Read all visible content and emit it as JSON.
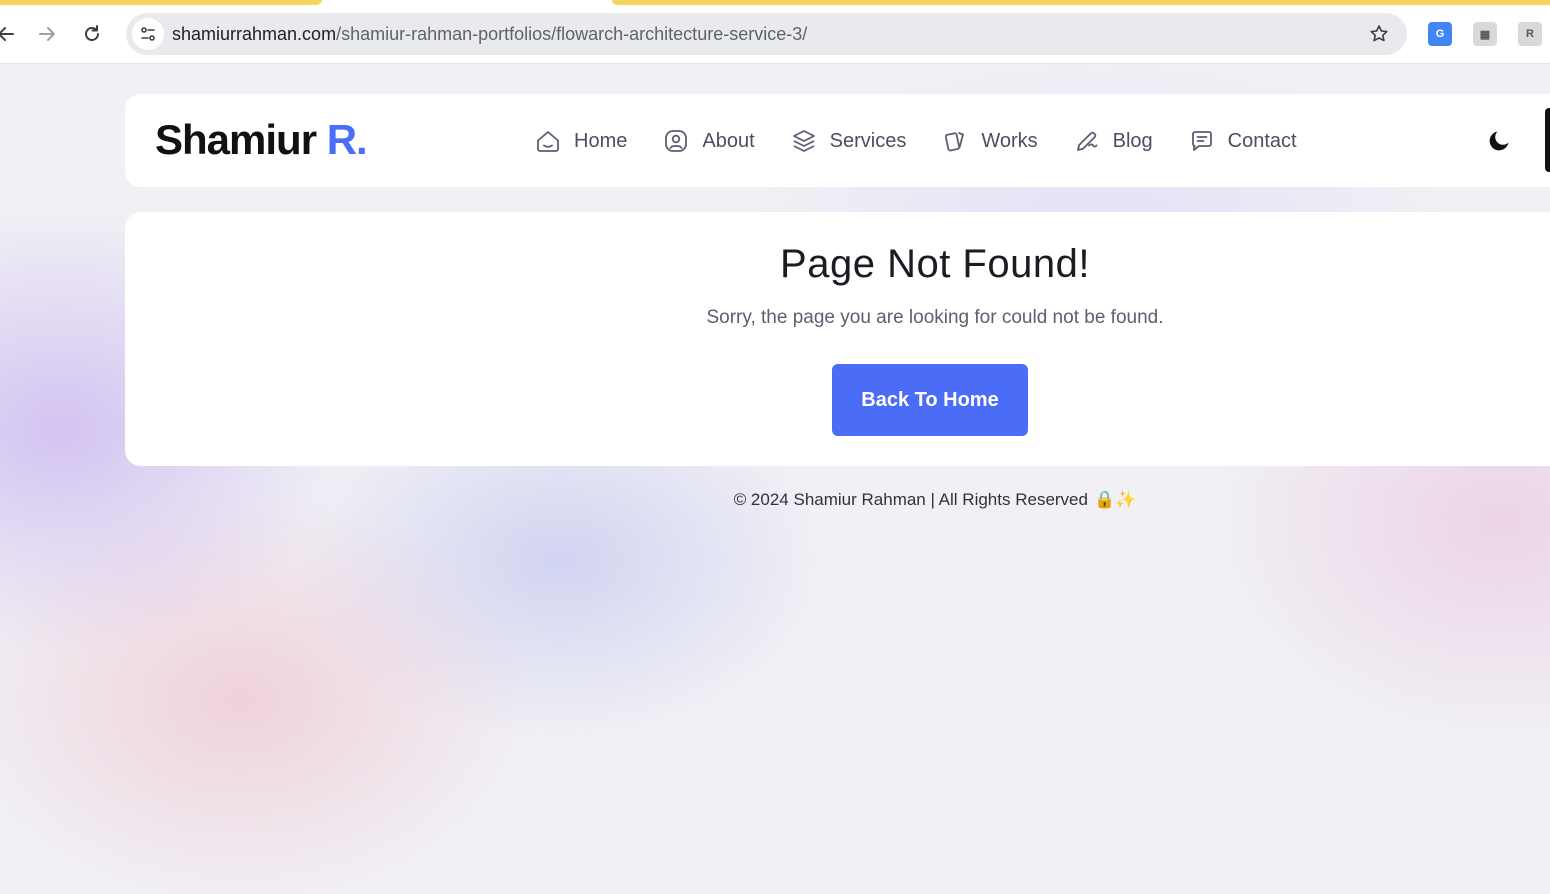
{
  "browser": {
    "url_host": "shamiurrahman.com",
    "url_path": "/shamiur-rahman-portfolios/flowarch-architecture-service-3/",
    "icons": [
      "back-arrow-icon",
      "forward-arrow-icon",
      "reload-icon",
      "site-info-icon",
      "bookmark-star-icon",
      "google-translate-icon",
      "extension-icon",
      "extension-icon"
    ]
  },
  "header": {
    "logo_main": "Shamiur",
    "logo_accent": "R.",
    "nav": [
      {
        "label": "Home",
        "icon": "home-icon"
      },
      {
        "label": "About",
        "icon": "user-icon"
      },
      {
        "label": "Services",
        "icon": "layers-icon"
      },
      {
        "label": "Works",
        "icon": "cards-icon"
      },
      {
        "label": "Blog",
        "icon": "pen-icon"
      },
      {
        "label": "Contact",
        "icon": "chat-icon"
      }
    ],
    "theme_toggle_icon": "moon-icon"
  },
  "notfound": {
    "title": "Page Not Found!",
    "subtitle": "Sorry, the page you are looking for could not be found.",
    "button": "Back To Home"
  },
  "footer": {
    "text": "© 2024 Shamiur Rahman | All Rights Reserved",
    "emoji": "🔒✨"
  },
  "colors": {
    "accent": "#4a6cf7",
    "tab_accent": "#f6d55c"
  }
}
